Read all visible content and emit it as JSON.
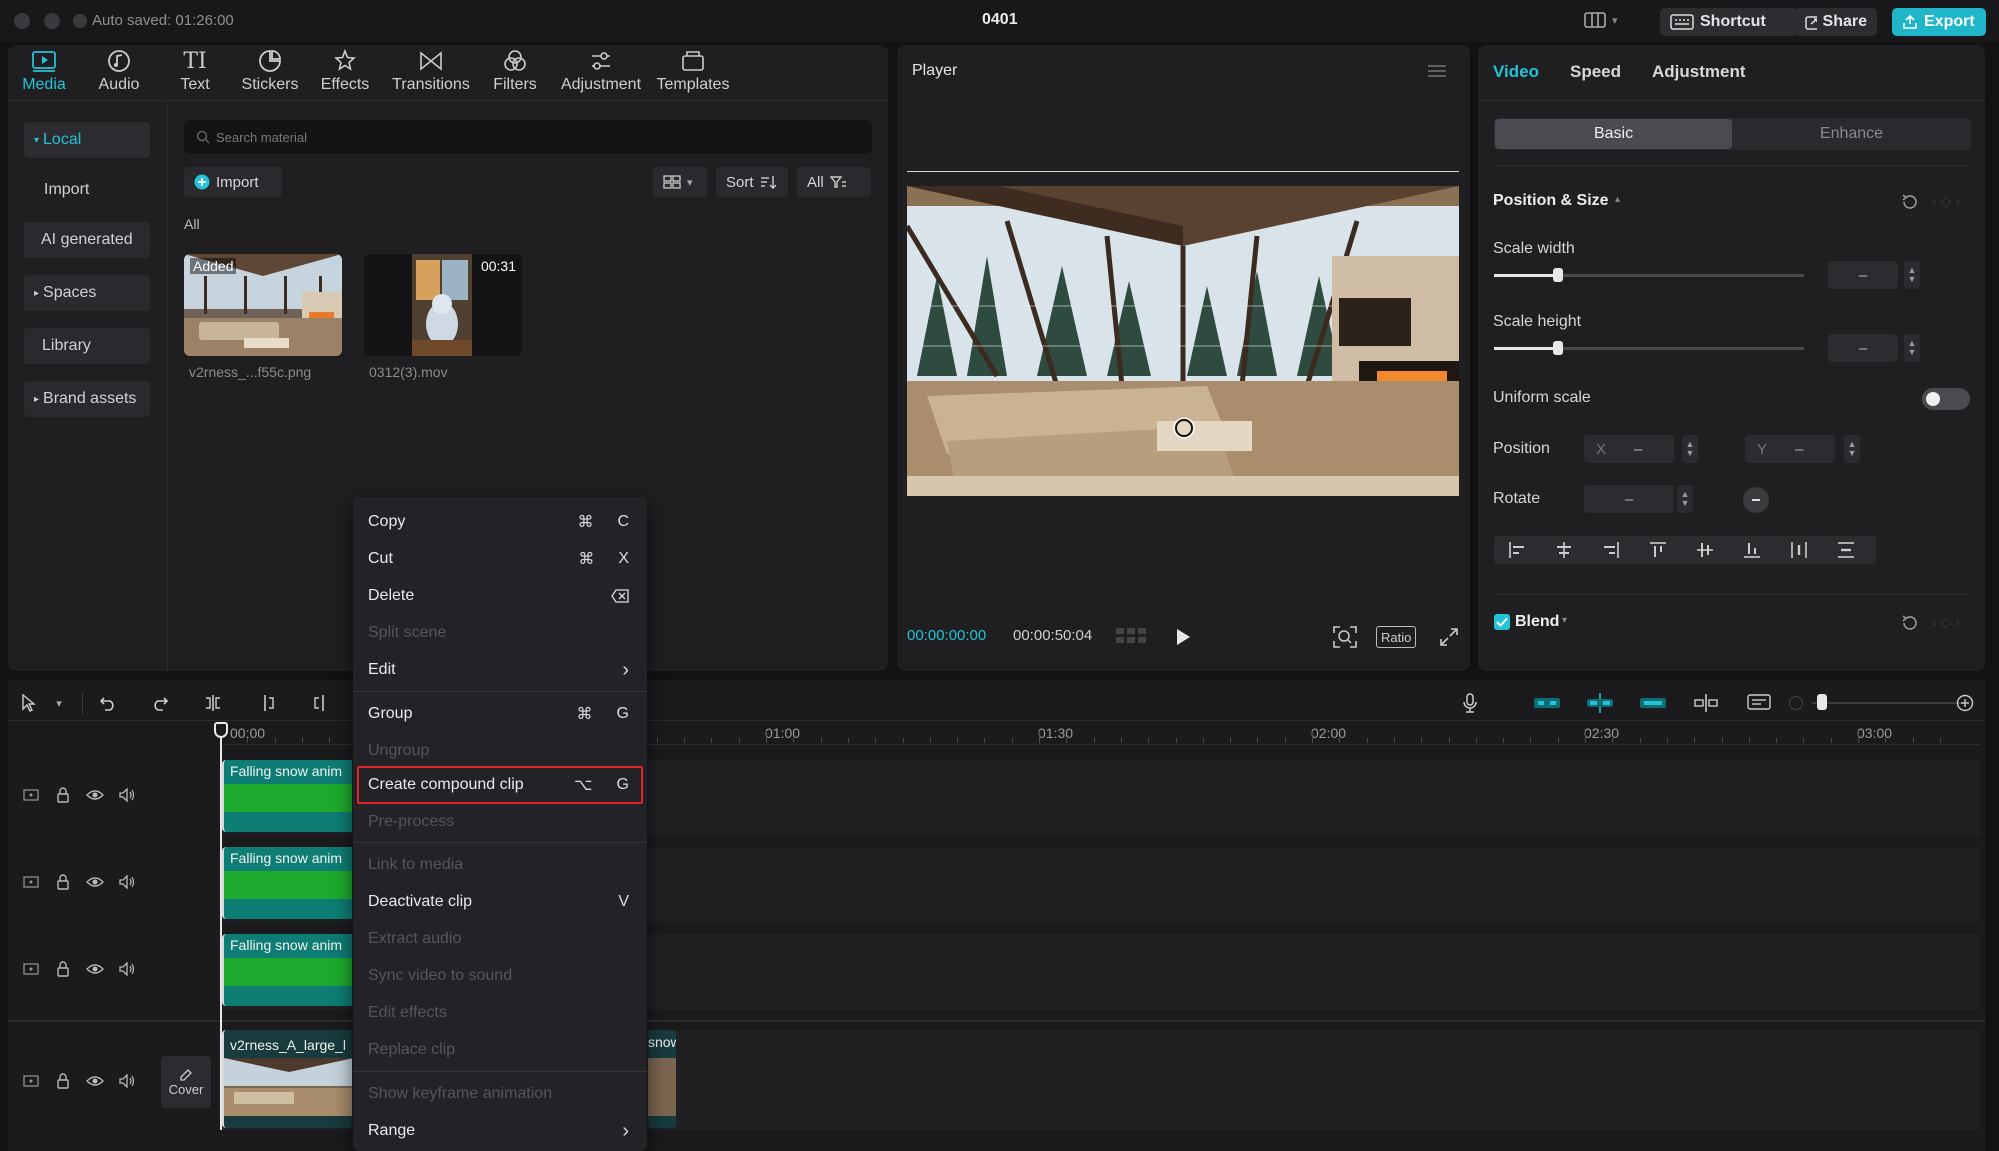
{
  "titlebar": {
    "autosave": "Auto saved: 01:26:00",
    "project": "0401",
    "shortcut": "Shortcut",
    "share": "Share",
    "export": "Export"
  },
  "media_tabs": [
    {
      "label": "Media",
      "icon": "media-icon"
    },
    {
      "label": "Audio",
      "icon": "audio-icon"
    },
    {
      "label": "Text",
      "icon": "text-icon"
    },
    {
      "label": "Stickers",
      "icon": "stickers-icon"
    },
    {
      "label": "Effects",
      "icon": "effects-icon"
    },
    {
      "label": "Transitions",
      "icon": "transitions-icon"
    },
    {
      "label": "Filters",
      "icon": "filters-icon"
    },
    {
      "label": "Adjustment",
      "icon": "adjustment-icon"
    },
    {
      "label": "Templates",
      "icon": "templates-icon"
    }
  ],
  "sidebar": {
    "local": "Local",
    "import": "Import",
    "ai": "AI generated",
    "spaces": "Spaces",
    "library": "Library",
    "brand": "Brand assets"
  },
  "library": {
    "search_placeholder": "Search material",
    "import": "Import",
    "sort": "Sort",
    "all_filter": "All",
    "all_heading": "All",
    "items": [
      {
        "name": "v2rness_...f55c.png",
        "badge": "Added"
      },
      {
        "name": "0312(3).mov",
        "duration": "00:31"
      }
    ]
  },
  "player": {
    "title": "Player",
    "current": "00:00:00:00",
    "total": "00:00:50:04",
    "ratio": "Ratio"
  },
  "inspector": {
    "tabs": [
      "Video",
      "Speed",
      "Adjustment"
    ],
    "subtabs": [
      "Basic",
      "Enhance"
    ],
    "section": "Position & Size",
    "scale_width": "Scale width",
    "scale_height": "Scale height",
    "uniform_scale": "Uniform scale",
    "position": "Position",
    "rotate": "Rotate",
    "pos_x_label": "X",
    "pos_y_label": "Y",
    "dash": "–",
    "blend": "Blend"
  },
  "timeline": {
    "ruler": [
      "00:00",
      "01:00",
      "01:30",
      "02:00",
      "02:30",
      "03:00"
    ],
    "cover": "Cover",
    "clips": [
      "Falling snow anim",
      "Falling snow anim",
      "Falling snow anim",
      "v2rness_A_large_l"
    ],
    "clip_tail": "snow"
  },
  "context_menu": {
    "copy": "Copy",
    "copy_key": "⌘",
    "copy_letter": "C",
    "cut": "Cut",
    "cut_key": "⌘",
    "cut_letter": "X",
    "delete": "Delete",
    "split_scene": "Split scene",
    "edit": "Edit",
    "group": "Group",
    "group_key": "⌘",
    "group_letter": "G",
    "ungroup": "Ungroup",
    "compound": "Create compound clip",
    "compound_key": "⌥",
    "compound_letter": "G",
    "preprocess": "Pre-process",
    "link_media": "Link to media",
    "deactivate": "Deactivate clip",
    "deactivate_letter": "V",
    "extract_audio": "Extract audio",
    "sync": "Sync video to sound",
    "edit_effects": "Edit effects",
    "replace": "Replace clip",
    "keyframe": "Show keyframe animation",
    "range": "Range",
    "submenu_arrow": "›"
  },
  "colors": {
    "accent": "#22c3d6",
    "highlight_border": "#e0242a"
  }
}
